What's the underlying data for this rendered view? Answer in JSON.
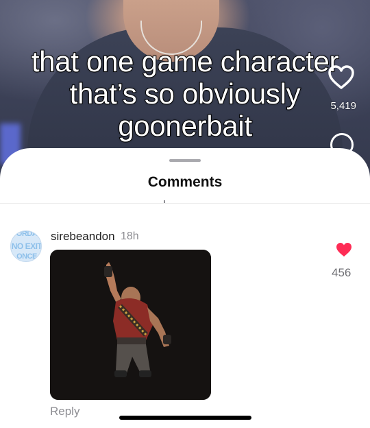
{
  "video": {
    "caption": "that one game character\nthat’s so obviously\ngoonerbait",
    "like_count": "5,419",
    "like_icon": "heart-outline-icon",
    "comment_icon": "comment-bubble-icon"
  },
  "comments_sheet": {
    "title": "Comments",
    "comments": [
      {
        "avatar_text": [
          "ORDA",
          "NO EXIT",
          "ONCE"
        ],
        "username": "sirebeandon",
        "time": "18h",
        "attachment": "dancing-heavy-gif",
        "like_count": "456",
        "liked": true,
        "reply_label": "Reply"
      }
    ]
  },
  "colors": {
    "like_red": "#fe2c55",
    "avatar_bg": "#d7e8f8",
    "muted_text": "#8e8e93"
  }
}
